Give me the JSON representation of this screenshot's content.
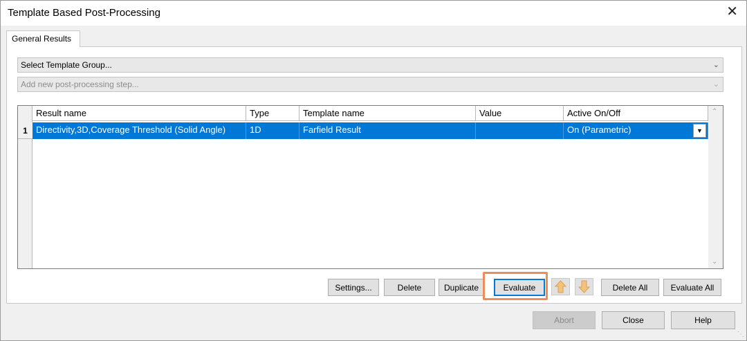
{
  "window": {
    "title": "Template Based Post-Processing",
    "close_glyph": "✕"
  },
  "tabs": [
    {
      "label": "General Results"
    }
  ],
  "template_group_select": {
    "value": "Select Template Group..."
  },
  "postprocessing_step_select": {
    "value": "Add new post-processing step..."
  },
  "table": {
    "columns": [
      "Result name",
      "Type",
      "Template name",
      "Value",
      "Active On/Off"
    ],
    "rows": [
      {
        "index": "1",
        "result_name": "Directivity,3D,Coverage Threshold (Solid Angle)",
        "type": "1D",
        "template_name": "Farfield Result",
        "value": "",
        "active": "On (Parametric)"
      }
    ]
  },
  "toolbar": {
    "settings": "Settings...",
    "delete": "Delete",
    "duplicate": "Duplicate",
    "evaluate": "Evaluate",
    "move_up_icon": "arrow-up-icon",
    "move_down_icon": "arrow-down-icon",
    "delete_all": "Delete All",
    "evaluate_all": "Evaluate All"
  },
  "footer": {
    "abort": "Abort",
    "close": "Close",
    "help": "Help"
  },
  "colors": {
    "selection": "#0078d7",
    "highlight": "#f08c5a",
    "arrow_fill": "#f5c27a"
  }
}
